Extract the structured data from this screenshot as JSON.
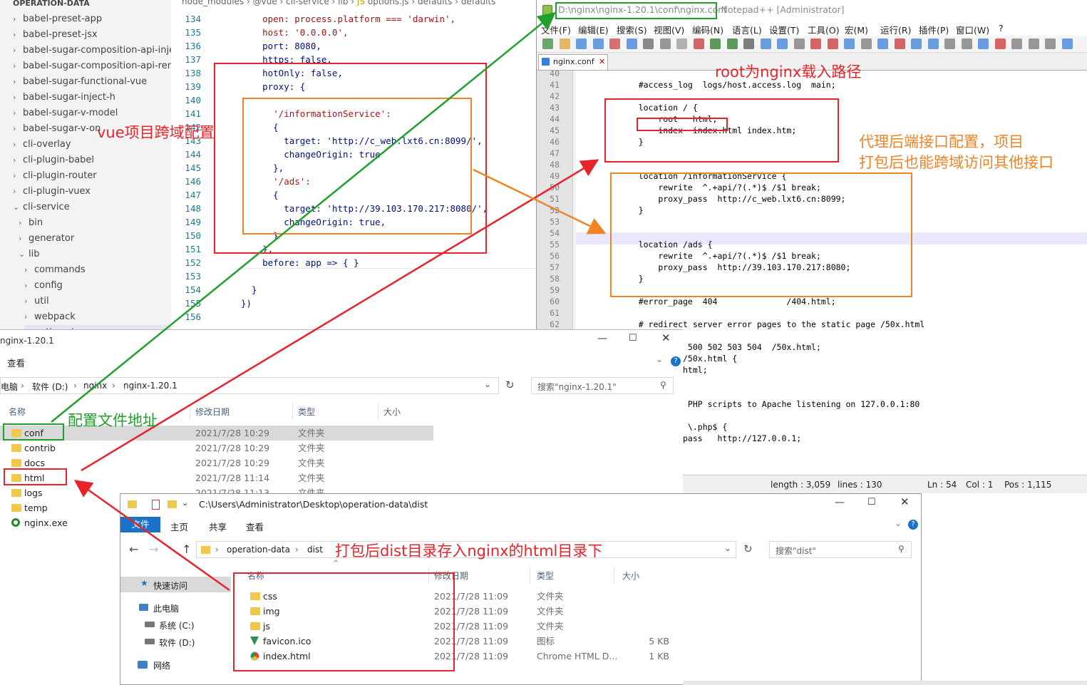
{
  "vscode": {
    "tabs_breadcrumb": [
      "node_modules",
      "@vue",
      "cli-service",
      "lib",
      "options.js",
      "defaults",
      "defaults"
    ],
    "tree": [
      {
        "label": "OPERATION-DATA",
        "chev": ""
      },
      {
        "label": "babel-preset-app",
        "chev": "›"
      },
      {
        "label": "babel-preset-jsx",
        "chev": "›"
      },
      {
        "label": "babel-sugar-composition-api-inje...",
        "chev": "›"
      },
      {
        "label": "babel-sugar-composition-api-ren...",
        "chev": "›"
      },
      {
        "label": "babel-sugar-functional-vue",
        "chev": "›"
      },
      {
        "label": "babel-sugar-inject-h",
        "chev": "›"
      },
      {
        "label": "babel-sugar-v-model",
        "chev": "›"
      },
      {
        "label": "babel-sugar-v-on",
        "chev": "›"
      },
      {
        "label": "cli-overlay",
        "chev": "›"
      },
      {
        "label": "cli-plugin-babel",
        "chev": "›"
      },
      {
        "label": "cli-plugin-router",
        "chev": "›"
      },
      {
        "label": "cli-plugin-vuex",
        "chev": "›"
      },
      {
        "label": "cli-service",
        "chev": "⌄"
      },
      {
        "label": "bin",
        "chev": "›"
      },
      {
        "label": "generator",
        "chev": "›"
      },
      {
        "label": "lib",
        "chev": "⌄"
      },
      {
        "label": "commands",
        "chev": "›"
      },
      {
        "label": "config",
        "chev": "›"
      },
      {
        "label": "util",
        "chev": "›"
      },
      {
        "label": "webpack",
        "chev": "›"
      },
      {
        "label": "options.js",
        "chev": "JS"
      }
    ],
    "code": [
      {
        "n": "134",
        "t": "    open: process.platform === 'darwin',"
      },
      {
        "n": "135",
        "t": "    host: '0.0.0.0',"
      },
      {
        "n": "136",
        "t": "    port: 8080,"
      },
      {
        "n": "137",
        "t": "    https: false,"
      },
      {
        "n": "138",
        "t": "    hotOnly: false,"
      },
      {
        "n": "139",
        "t": "    proxy: {"
      },
      {
        "n": "140",
        "t": ""
      },
      {
        "n": "141",
        "t": "      '/informationService':"
      },
      {
        "n": "142",
        "t": "      {"
      },
      {
        "n": "143",
        "t": "        target: 'http://c_web.lxt6.cn:8099/',"
      },
      {
        "n": "144",
        "t": "        changeOrigin: true"
      },
      {
        "n": "145",
        "t": "      },"
      },
      {
        "n": "146",
        "t": "      '/ads':"
      },
      {
        "n": "147",
        "t": "      {"
      },
      {
        "n": "148",
        "t": "        target: 'http://39.103.170.217:8080/',"
      },
      {
        "n": "149",
        "t": "        changeOrigin: true,"
      },
      {
        "n": "150",
        "t": "      }"
      },
      {
        "n": "151",
        "t": "    },"
      },
      {
        "n": "152",
        "t": "    before: app => { }"
      },
      {
        "n": "153",
        "t": ""
      },
      {
        "n": "154",
        "t": "  }"
      },
      {
        "n": "155",
        "t": "})"
      },
      {
        "n": "156",
        "t": ""
      }
    ]
  },
  "notepad": {
    "title_path": "D:\\nginx\\nginx-1.20.1\\conf\\nginx.conf",
    "title_rest": " - Notepad++ [Administrator]",
    "menu": [
      "文件(F)",
      "编辑(E)",
      "搜索(S)",
      "视图(V)",
      "编码(N)",
      "语言(L)",
      "设置(T)",
      "工具(O)",
      "宏(M)",
      "运行(R)",
      "插件(P)",
      "窗口(W)",
      "?"
    ],
    "tab": "nginx.conf",
    "lines": [
      {
        "n": "40",
        "t": ""
      },
      {
        "n": "41",
        "t": "    #access_log  logs/host.access.log  main;"
      },
      {
        "n": "42",
        "t": ""
      },
      {
        "n": "43",
        "t": "    location / {"
      },
      {
        "n": "44",
        "t": "        root   html;"
      },
      {
        "n": "45",
        "t": "        index  index.html index.htm;"
      },
      {
        "n": "46",
        "t": "    }"
      },
      {
        "n": "47",
        "t": ""
      },
      {
        "n": "48",
        "t": ""
      },
      {
        "n": "49",
        "t": "    location /informationService {"
      },
      {
        "n": "50",
        "t": "        rewrite  ^.+api/?(.*)$ /$1 break;"
      },
      {
        "n": "51",
        "t": "        proxy_pass  http://c_web.lxt6.cn:8099;"
      },
      {
        "n": "52",
        "t": "    }"
      },
      {
        "n": "53",
        "t": ""
      },
      {
        "n": "54",
        "t": ""
      },
      {
        "n": "55",
        "t": "    location /ads {"
      },
      {
        "n": "56",
        "t": "        rewrite  ^.+api/?(.*)$ /$1 break;"
      },
      {
        "n": "57",
        "t": "        proxy_pass  http://39.103.170.217:8080;"
      },
      {
        "n": "58",
        "t": "    }"
      },
      {
        "n": "59",
        "t": ""
      },
      {
        "n": "60",
        "t": "    #error_page  404              /404.html;"
      },
      {
        "n": "61",
        "t": ""
      },
      {
        "n": "62",
        "t": "    # redirect server error pages to the static page /50x.html"
      },
      {
        "n": "",
        "t": ""
      },
      {
        "n": "",
        "t": "              500 502 503 504  /50x.html;"
      },
      {
        "n": "",
        "t": "             /50x.html {"
      },
      {
        "n": "",
        "t": "             html;"
      },
      {
        "n": "",
        "t": ""
      },
      {
        "n": "",
        "t": ""
      },
      {
        "n": "",
        "t": "              PHP scripts to Apache listening on 127.0.0.1:80"
      },
      {
        "n": "",
        "t": ""
      },
      {
        "n": "",
        "t": "              \\.php$ {"
      },
      {
        "n": "",
        "t": "             pass   http://127.0.0.1;"
      }
    ],
    "status": {
      "length": "length : 3,059",
      "lines": "lines : 130",
      "ln": "Ln : 54",
      "col": "Col : 1",
      "pos": "Pos : 1,115"
    },
    "under_status": "    #     .   "
  },
  "explorer1": {
    "title": "nginx-1.20.1",
    "view_label": "查看",
    "breadcrumb": [
      "电脑",
      "软件 (D:)",
      "nginx",
      "nginx-1.20.1"
    ],
    "search_placeholder": "搜索\"nginx-1.20.1\"",
    "columns": [
      "名称",
      "修改日期",
      "类型",
      "大小"
    ],
    "rows": [
      {
        "name": "conf",
        "date": "2021/7/28 10:29",
        "type": "文件夹",
        "size": ""
      },
      {
        "name": "contrib",
        "date": "2021/7/28 10:29",
        "type": "文件夹",
        "size": ""
      },
      {
        "name": "docs",
        "date": "2021/7/28 10:29",
        "type": "文件夹",
        "size": ""
      },
      {
        "name": "html",
        "date": "2021/7/28 11:14",
        "type": "文件夹",
        "size": ""
      },
      {
        "name": "logs",
        "date": "2021/7/28 11:13",
        "type": "文件夹",
        "size": ""
      },
      {
        "name": "temp",
        "date": "",
        "type": "",
        "size": ""
      },
      {
        "name": "nginx.exe",
        "date": "",
        "type": "",
        "size": ""
      }
    ]
  },
  "explorer2": {
    "path": "C:\\Users\\Administrator\\Desktop\\operation-data\\dist",
    "ribbon": [
      "文件",
      "主页",
      "共享",
      "查看"
    ],
    "breadcrumb": [
      "operation-data",
      "dist"
    ],
    "search_placeholder": "搜索\"dist\"",
    "columns": [
      "名称",
      "修改日期",
      "类型",
      "大小"
    ],
    "nav": [
      "快速访问",
      "此电脑",
      "系统 (C:)",
      "软件 (D:)",
      "网络"
    ],
    "rows": [
      {
        "name": "css",
        "date": "2021/7/28 11:09",
        "type": "文件夹",
        "size": ""
      },
      {
        "name": "img",
        "date": "2021/7/28 11:09",
        "type": "文件夹",
        "size": ""
      },
      {
        "name": "js",
        "date": "2021/7/28 11:09",
        "type": "文件夹",
        "size": ""
      },
      {
        "name": "favicon.ico",
        "date": "2021/7/28 11:09",
        "type": "图标",
        "size": "5 KB"
      },
      {
        "name": "index.html",
        "date": "2021/7/28 11:09",
        "type": "Chrome HTML D...",
        "size": "1 KB"
      }
    ]
  },
  "annotations": {
    "vue_proxy": "vue项目跨域配置",
    "root_path": "root为nginx载入路径",
    "proxy_backend_1": "代理后端接口配置，项目",
    "proxy_backend_2": "打包后也能跨域访问其他接口",
    "conf_addr": "配置文件地址",
    "dist_to_html": "打包后dist目录存入nginx的html目录下"
  },
  "colors": {
    "red": "#e8232a",
    "green": "#1fa02a",
    "orange": "#f08323"
  }
}
